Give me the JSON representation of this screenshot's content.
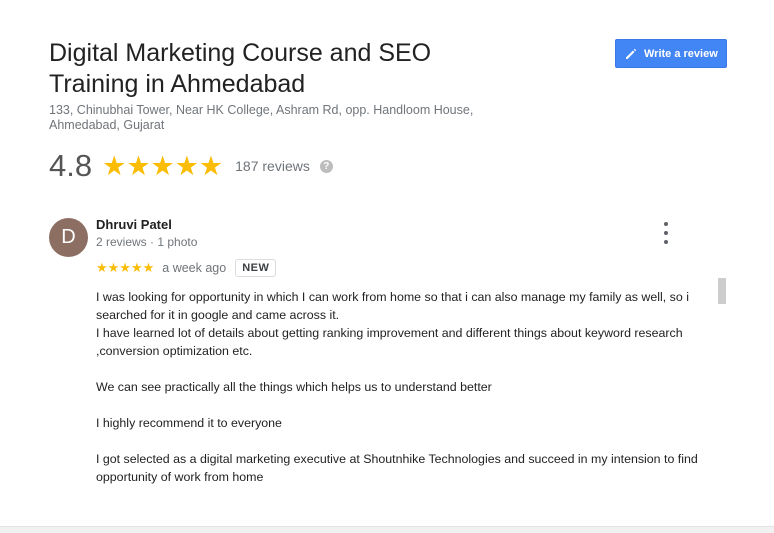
{
  "business": {
    "name": "Digital Marketing Course and SEO Training in Ahmedabad",
    "address": "133, Chinubhai Tower, Near HK College, Ashram Rd, opp. Handloom House, Ahmedabad, Gujarat",
    "rating": "4.8",
    "rating_value": 4.8,
    "stars": "★★★★★",
    "reviews_label": "187 reviews",
    "help_icon_glyph": "?"
  },
  "write_review": {
    "label": "Write a review",
    "icon": "pencil-icon"
  },
  "review": {
    "author_initial": "D",
    "author": "Dhruvi Patel",
    "meta": "2 reviews · 1 photo",
    "stars": "★★★★★",
    "rating_value": 5,
    "time": "a week ago",
    "badge": "NEW",
    "text": "I was looking for opportunity in which I can work from home so that i can also manage my family as well, so i searched for it in google and came across it.\nI have learned lot of details about getting ranking improvement and different things about keyword research ,conversion optimization etc.\n\nWe can see practically all the things which helps us to understand better\n\nI highly recommend it to everyone\n\nI got selected as a digital marketing executive at Shoutnhike Technologies and succeed in my intension to find opportunity of work from home"
  },
  "colors": {
    "accent": "#4285f4",
    "star": "#fbbc04",
    "avatar": "#8d6e63"
  }
}
